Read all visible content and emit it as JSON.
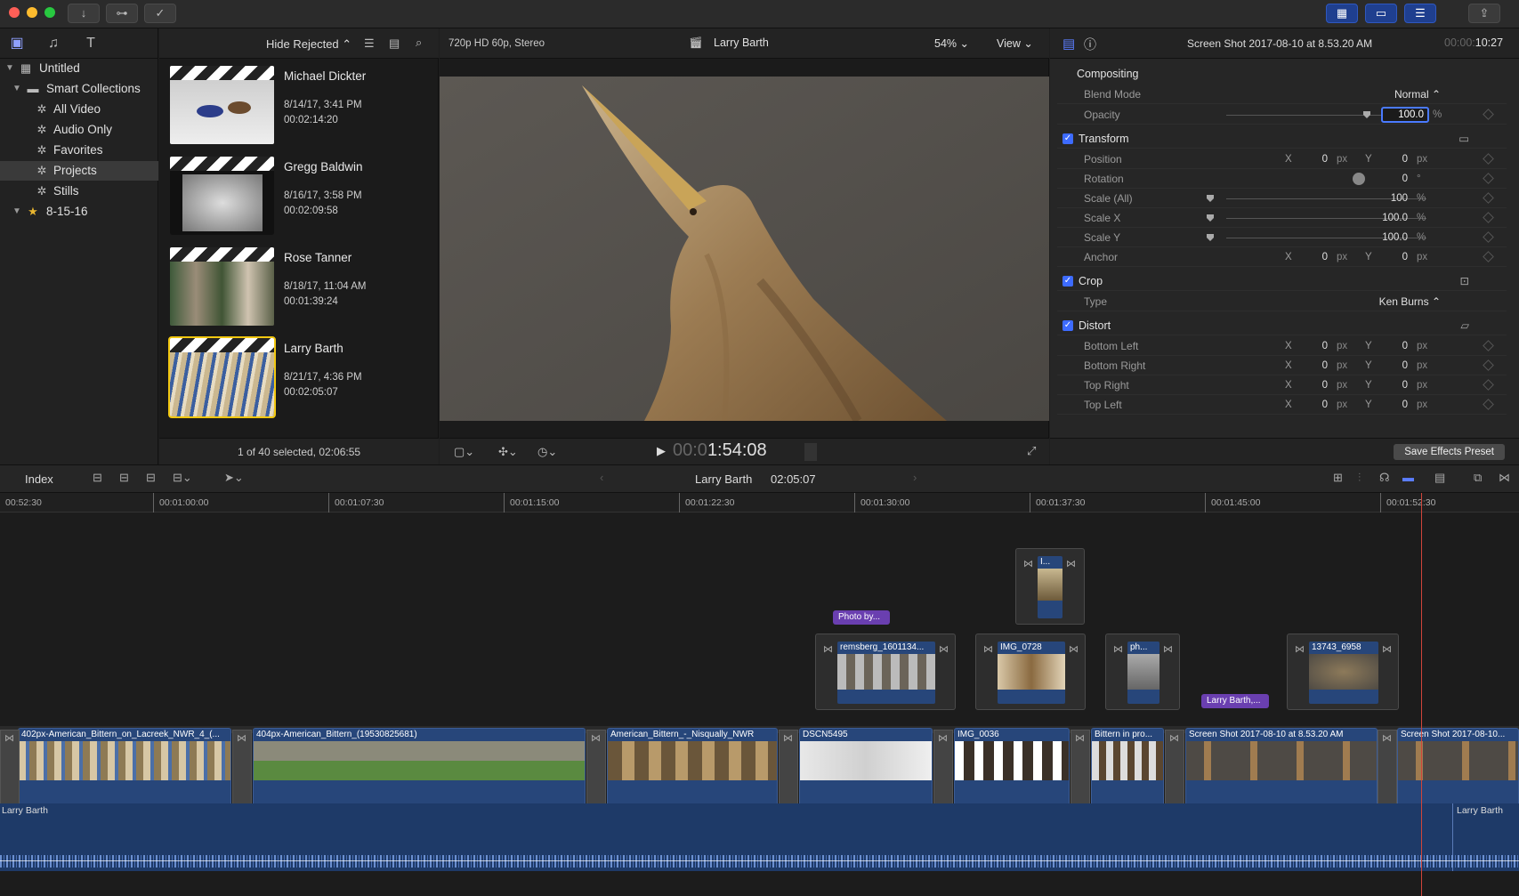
{
  "toolbar": {
    "download_icon": "↓",
    "key_icon": "⊶",
    "check_icon": "✓",
    "share_icon": "⇪"
  },
  "library": {
    "items": [
      {
        "label": "Untitled",
        "level": 0
      },
      {
        "label": "Smart Collections",
        "level": 1
      },
      {
        "label": "All Video",
        "level": 2
      },
      {
        "label": "Audio Only",
        "level": 2
      },
      {
        "label": "Favorites",
        "level": 2
      },
      {
        "label": "Projects",
        "level": 2,
        "selected": true
      },
      {
        "label": "Stills",
        "level": 2
      },
      {
        "label": "8-15-16",
        "level": 1
      }
    ]
  },
  "browser": {
    "filter": "Hide Rejected",
    "projects": [
      {
        "name": "Michael Dickter",
        "date": "8/14/17, 3:41 PM",
        "duration": "00:02:14:20"
      },
      {
        "name": "Gregg Baldwin",
        "date": "8/16/17, 3:58 PM",
        "duration": "00:02:09:58"
      },
      {
        "name": "Rose Tanner",
        "date": "8/18/17, 11:04 AM",
        "duration": "00:01:39:24"
      },
      {
        "name": "Larry Barth",
        "date": "8/21/17, 4:36 PM",
        "duration": "00:02:05:07",
        "selected": true
      }
    ],
    "status": "1 of 40 selected, 02:06:55"
  },
  "viewer": {
    "format": "720p HD 60p, Stereo",
    "project": "Larry Barth",
    "zoom": "54%",
    "view": "View",
    "timecode_dim": "00:0",
    "timecode": "1:54:08"
  },
  "inspector": {
    "title": "Screen Shot 2017-08-10 at 8.53.20 AM",
    "duration_dim": "00:00:",
    "duration": "10:27",
    "compositing": "Compositing",
    "blend_label": "Blend Mode",
    "blend_value": "Normal",
    "opacity_label": "Opacity",
    "opacity_value": "100.0",
    "pct": "%",
    "transform": "Transform",
    "position": "Position",
    "rotation": "Rotation",
    "rotation_value": "0",
    "deg": "°",
    "scale_all": "Scale (All)",
    "scale_all_value": "100",
    "scale_x": "Scale X",
    "scale_x_value": "100.0",
    "scale_y": "Scale Y",
    "scale_y_value": "100.0",
    "anchor": "Anchor",
    "crop": "Crop",
    "type_label": "Type",
    "type_value": "Ken Burns",
    "distort": "Distort",
    "bottom_left": "Bottom Left",
    "bottom_right": "Bottom Right",
    "top_right": "Top Right",
    "top_left": "Top Left",
    "x": "X",
    "y": "Y",
    "zero": "0",
    "px": "px",
    "save_preset": "Save Effects Preset"
  },
  "timeline": {
    "index": "Index",
    "project": "Larry Barth",
    "duration": "02:05:07",
    "ruler": [
      "00:52:30",
      "00:01:00:00",
      "00:01:07:30",
      "00:01:15:00",
      "00:01:22:30",
      "00:01:30:00",
      "00:01:37:30",
      "00:01:45:00",
      "00:01:52:30"
    ],
    "main_clips": [
      "402px-American_Bittern_on_Lacreek_NWR_4_(...",
      "404px-American_Bittern_(19530825681)",
      "American_Bittern_-_Nisqually_NWR",
      "DSCN5495",
      "IMG_0036",
      "Bittern in pro...",
      "Screen Shot 2017-08-10 at 8.53.20 AM",
      "Screen Shot 2017-08-10..."
    ],
    "connected": [
      "remsberg_1601134...",
      "IMG_0728",
      "ph...",
      "13743_6958",
      "I..."
    ],
    "titles": [
      "Photo by...",
      "Larry Barth,..."
    ],
    "audio": "Larry Barth",
    "audio_end": "Larry Barth"
  }
}
